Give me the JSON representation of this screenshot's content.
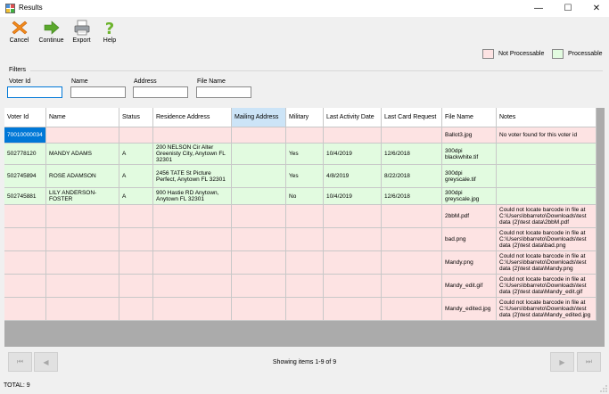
{
  "window": {
    "title": "Results",
    "min_glyph": "—",
    "max_glyph": "☐",
    "close_glyph": "✕"
  },
  "toolbar": {
    "cancel_label": "Cancel",
    "continue_label": "Continue",
    "export_label": "Export",
    "help_label": "Help"
  },
  "legend": {
    "not_processable": "Not Processable",
    "processable": "Processable",
    "not_processable_color": "#fde3e3",
    "processable_color": "#e2fbe0"
  },
  "filters": {
    "title": "Filters",
    "voter_id_label": "Voter Id",
    "name_label": "Name",
    "address_label": "Address",
    "file_name_label": "File Name",
    "voter_id_value": "",
    "name_value": "",
    "address_value": "",
    "file_name_value": ""
  },
  "grid": {
    "columns": [
      "Voter Id",
      "Name",
      "Status",
      "Residence Address",
      "Mailing Address",
      "Military",
      "Last Activity Date",
      "Last Card Request",
      "File Name",
      "Notes"
    ],
    "rows": [
      {
        "state": "bad",
        "cells": [
          "70010000034",
          "",
          "",
          "",
          "",
          "",
          "",
          "",
          "Ballot3.jpg",
          "No voter found for this voter id"
        ]
      },
      {
        "state": "good",
        "cells": [
          "502778120",
          "MANDY ADAMS",
          "A",
          "200 NELSON Cir Alter Greenisty City, Anytown FL 32301",
          "",
          "Yes",
          "10/4/2019",
          "12/6/2018",
          "300dpi blackwhite.tif",
          ""
        ]
      },
      {
        "state": "good",
        "cells": [
          "502745894",
          "ROSE ADAMSON",
          "A",
          "2456 TATE St Picture Perfect, Anytown FL 32301",
          "",
          "Yes",
          "4/8/2019",
          "8/22/2018",
          "300dpi greyscale.tif",
          ""
        ]
      },
      {
        "state": "good",
        "cells": [
          "502745881",
          "LILY ANDERSON-FOSTER",
          "A",
          "900 Hastie RD Anytown, Anytown FL 32301",
          "",
          "No",
          "10/4/2019",
          "12/6/2018",
          "300dpi greyscale.jpg",
          ""
        ]
      },
      {
        "state": "bad",
        "cells": [
          "",
          "",
          "",
          "",
          "",
          "",
          "",
          "",
          "2bbM.pdf",
          "Could not locate barcode in file at C:\\Users\\bbarreto\\Downloads\\test data (2)\\test data\\2bbM.pdf"
        ]
      },
      {
        "state": "bad",
        "cells": [
          "",
          "",
          "",
          "",
          "",
          "",
          "",
          "",
          "bad.png",
          "Could not locate barcode in file at C:\\Users\\bbarreto\\Downloads\\test data (2)\\test data\\bad.png"
        ]
      },
      {
        "state": "bad",
        "cells": [
          "",
          "",
          "",
          "",
          "",
          "",
          "",
          "",
          "Mandy.png",
          "Could not locate barcode in file at C:\\Users\\bbarreto\\Downloads\\test data (2)\\test data\\Mandy.png"
        ]
      },
      {
        "state": "bad",
        "cells": [
          "",
          "",
          "",
          "",
          "",
          "",
          "",
          "",
          "Mandy_edit.gif",
          "Could not locate barcode in file at C:\\Users\\bbarreto\\Downloads\\test data (2)\\test data\\Mandy_edit.gif"
        ]
      },
      {
        "state": "bad",
        "cells": [
          "",
          "",
          "",
          "",
          "",
          "",
          "",
          "",
          "Mandy_edited.jpg",
          "Could not locate barcode in file at C:\\Users\\bbarreto\\Downloads\\test data (2)\\test data\\Mandy_edited.jpg"
        ]
      }
    ]
  },
  "pager": {
    "status": "Showing items 1-9 of 9",
    "first_glyph": "⏮",
    "prev_glyph": "◀",
    "next_glyph": "▶",
    "last_glyph": "⏭"
  },
  "statusbar": {
    "total": "TOTAL: 9"
  }
}
